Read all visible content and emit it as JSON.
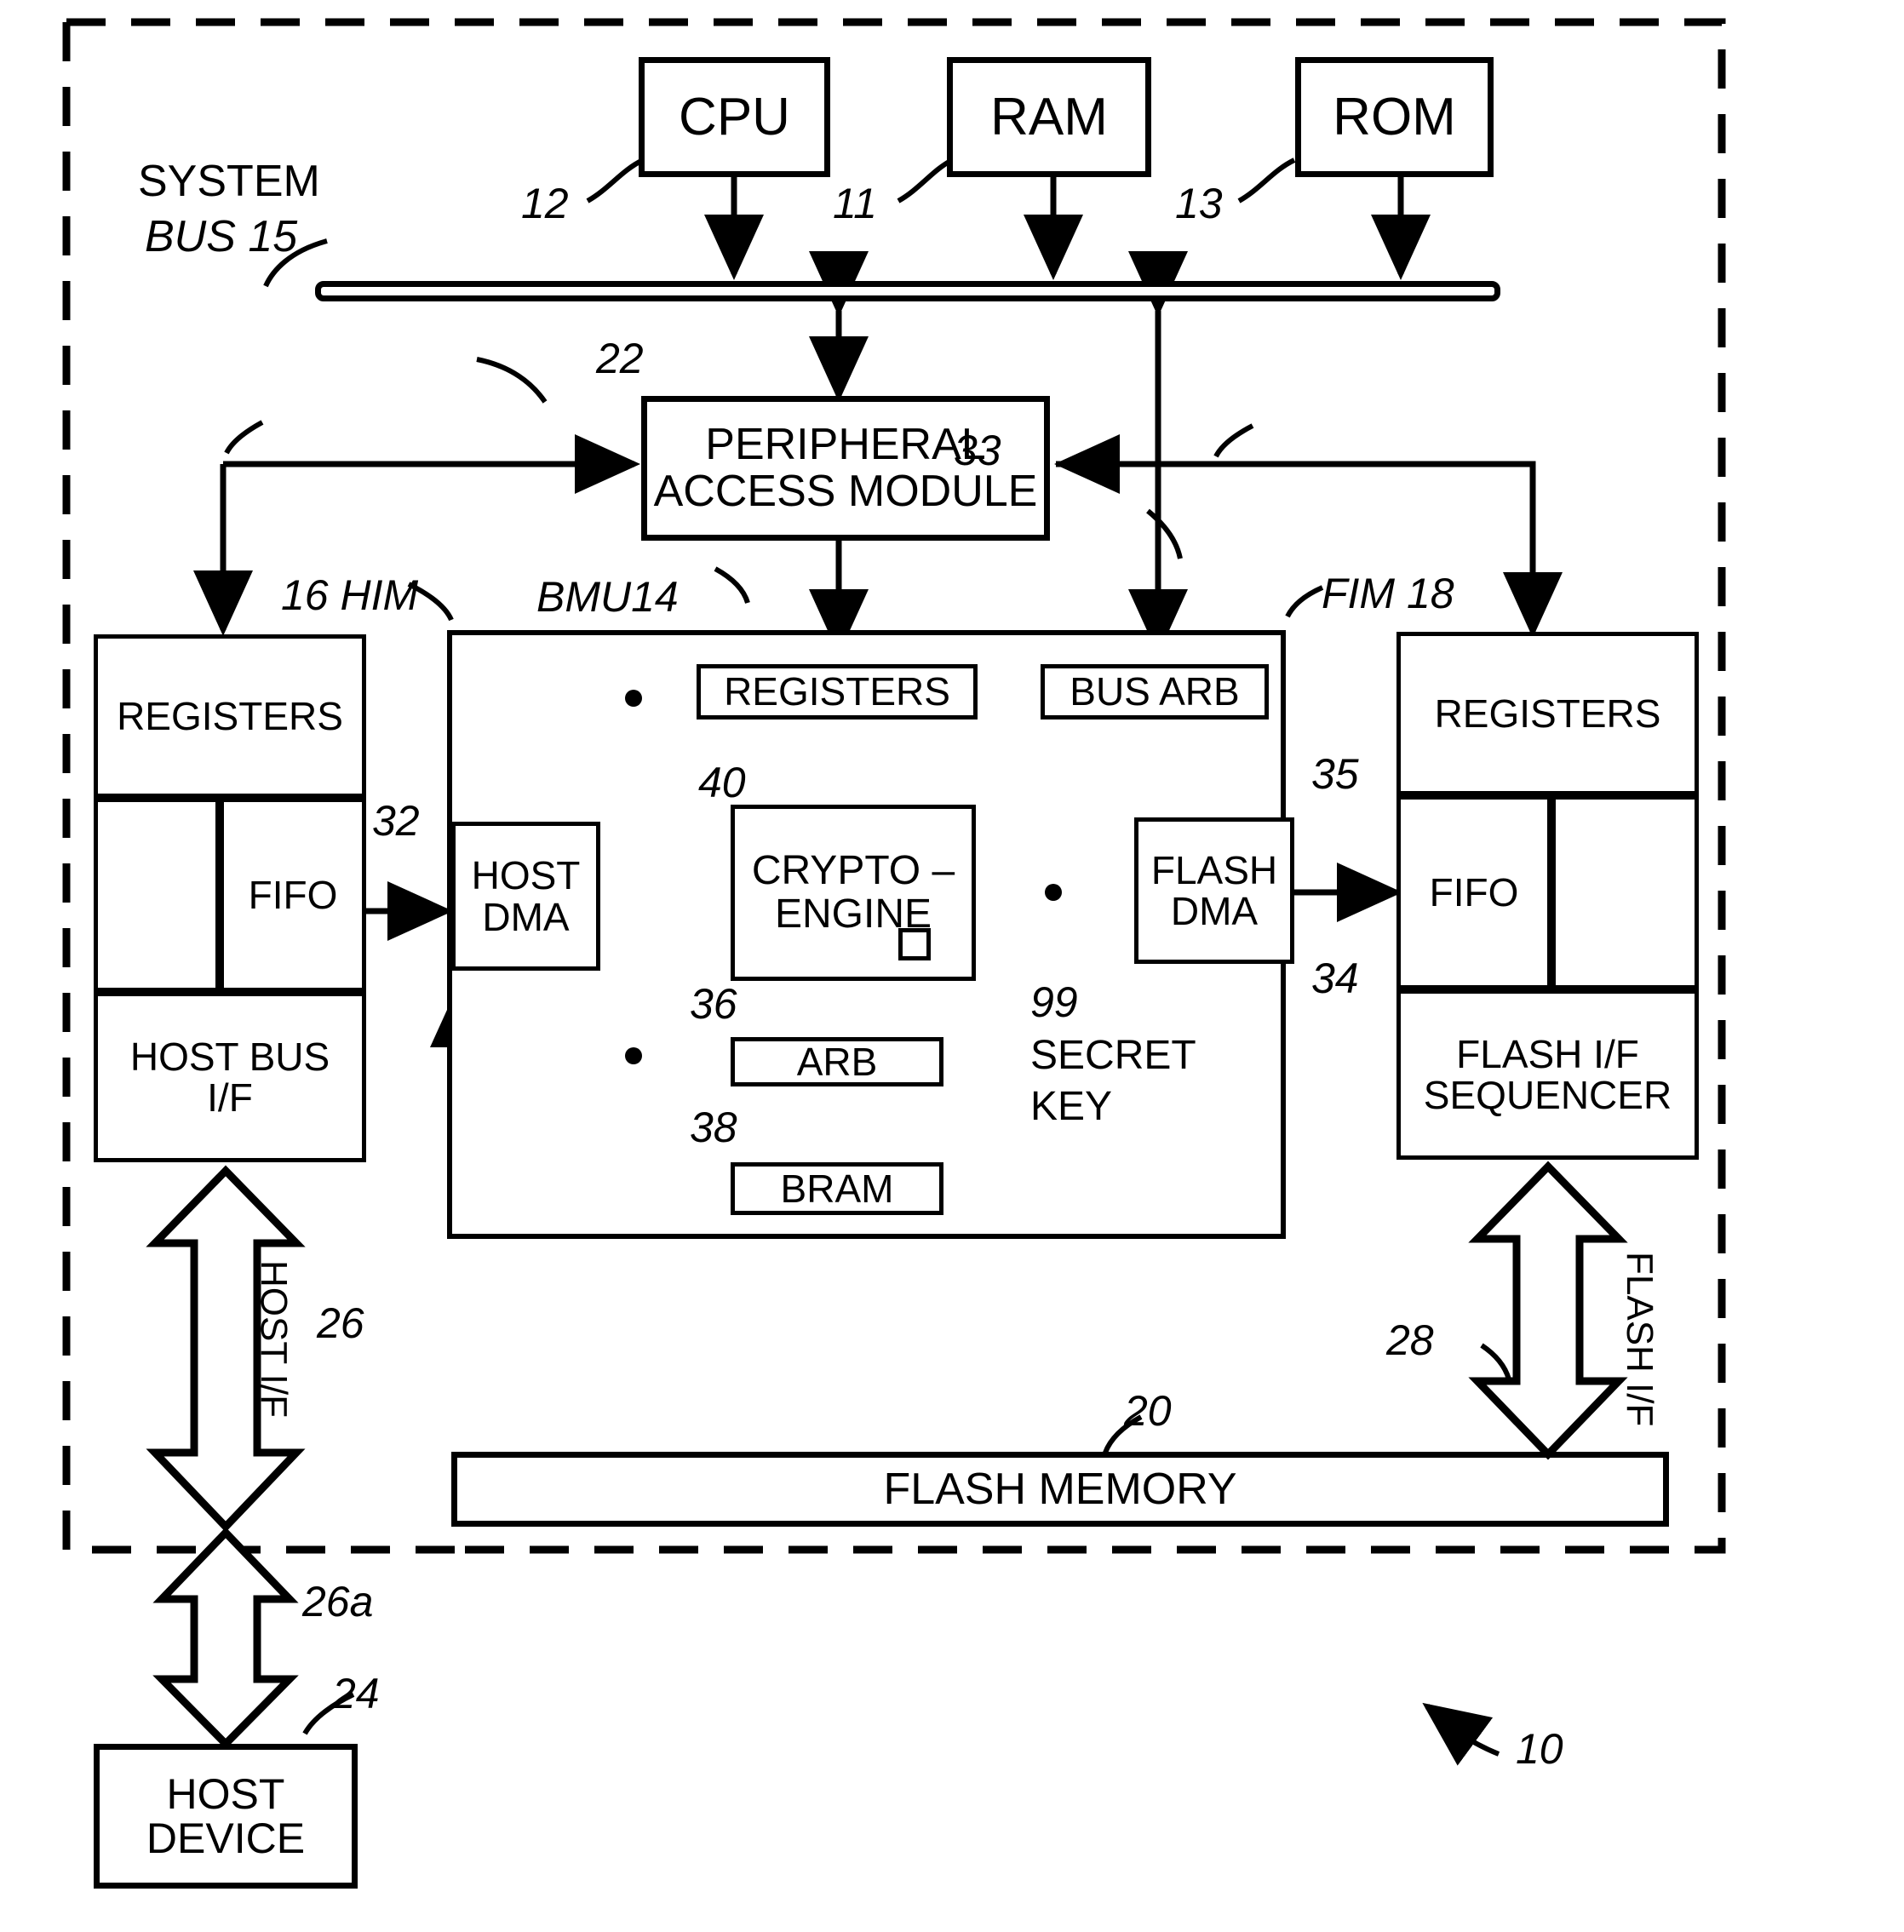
{
  "figure": {
    "label": "10",
    "dashed_boundary": true
  },
  "top_modules": [
    {
      "label": "CPU",
      "ref": "12"
    },
    {
      "label": "RAM",
      "ref": "11"
    },
    {
      "label": "ROM",
      "ref": "13"
    }
  ],
  "system_bus": {
    "label_line1": "SYSTEM",
    "label_line2": "BUS 15",
    "ref": "15"
  },
  "peripheral_access_module": {
    "line1": "PERIPHERAL",
    "line2": "ACCESS MODULE",
    "ref": "22"
  },
  "him": {
    "label": "16 HIM",
    "ref": "16",
    "registers": "REGISTERS",
    "fifo": "FIFO",
    "host_bus_if_line1": "HOST BUS",
    "host_bus_if_line2": "I/F"
  },
  "bmu": {
    "label": "BMU14",
    "ref": "14",
    "registers": {
      "label": "REGISTERS",
      "ref": "33"
    },
    "bus_arb": {
      "label": "BUS ARB",
      "ref": "35"
    },
    "host_dma": {
      "line1": "HOST",
      "line2": "DMA",
      "ref": "32"
    },
    "crypto_engine": {
      "line1": "CRYPTO –",
      "line2": "ENGINE",
      "ref": "40"
    },
    "flash_dma": {
      "line1": "FLASH",
      "line2": "DMA",
      "ref": "34"
    },
    "arb": {
      "label": "ARB",
      "ref": "36"
    },
    "bram": {
      "label": "BRAM",
      "ref": "38"
    },
    "secret_key": {
      "ref": "99",
      "line1": "SECRET",
      "line2": "KEY"
    }
  },
  "fim": {
    "label": "FIM 18",
    "ref": "18",
    "registers": "REGISTERS",
    "fifo": "FIFO",
    "sequencer_line1": "FLASH I/F",
    "sequencer_line2": "SEQUENCER"
  },
  "flash_memory": {
    "label": "FLASH MEMORY",
    "ref": "20"
  },
  "host_if": {
    "label": "HOST I/F",
    "ref": "26"
  },
  "host_if_ext": {
    "ref": "26a"
  },
  "flash_if": {
    "label": "FLASH I/F",
    "ref": "28"
  },
  "host_device": {
    "line1": "HOST",
    "line2": "DEVICE",
    "ref": "24"
  },
  "colors": {
    "ink": "#000000",
    "paper": "#ffffff"
  }
}
